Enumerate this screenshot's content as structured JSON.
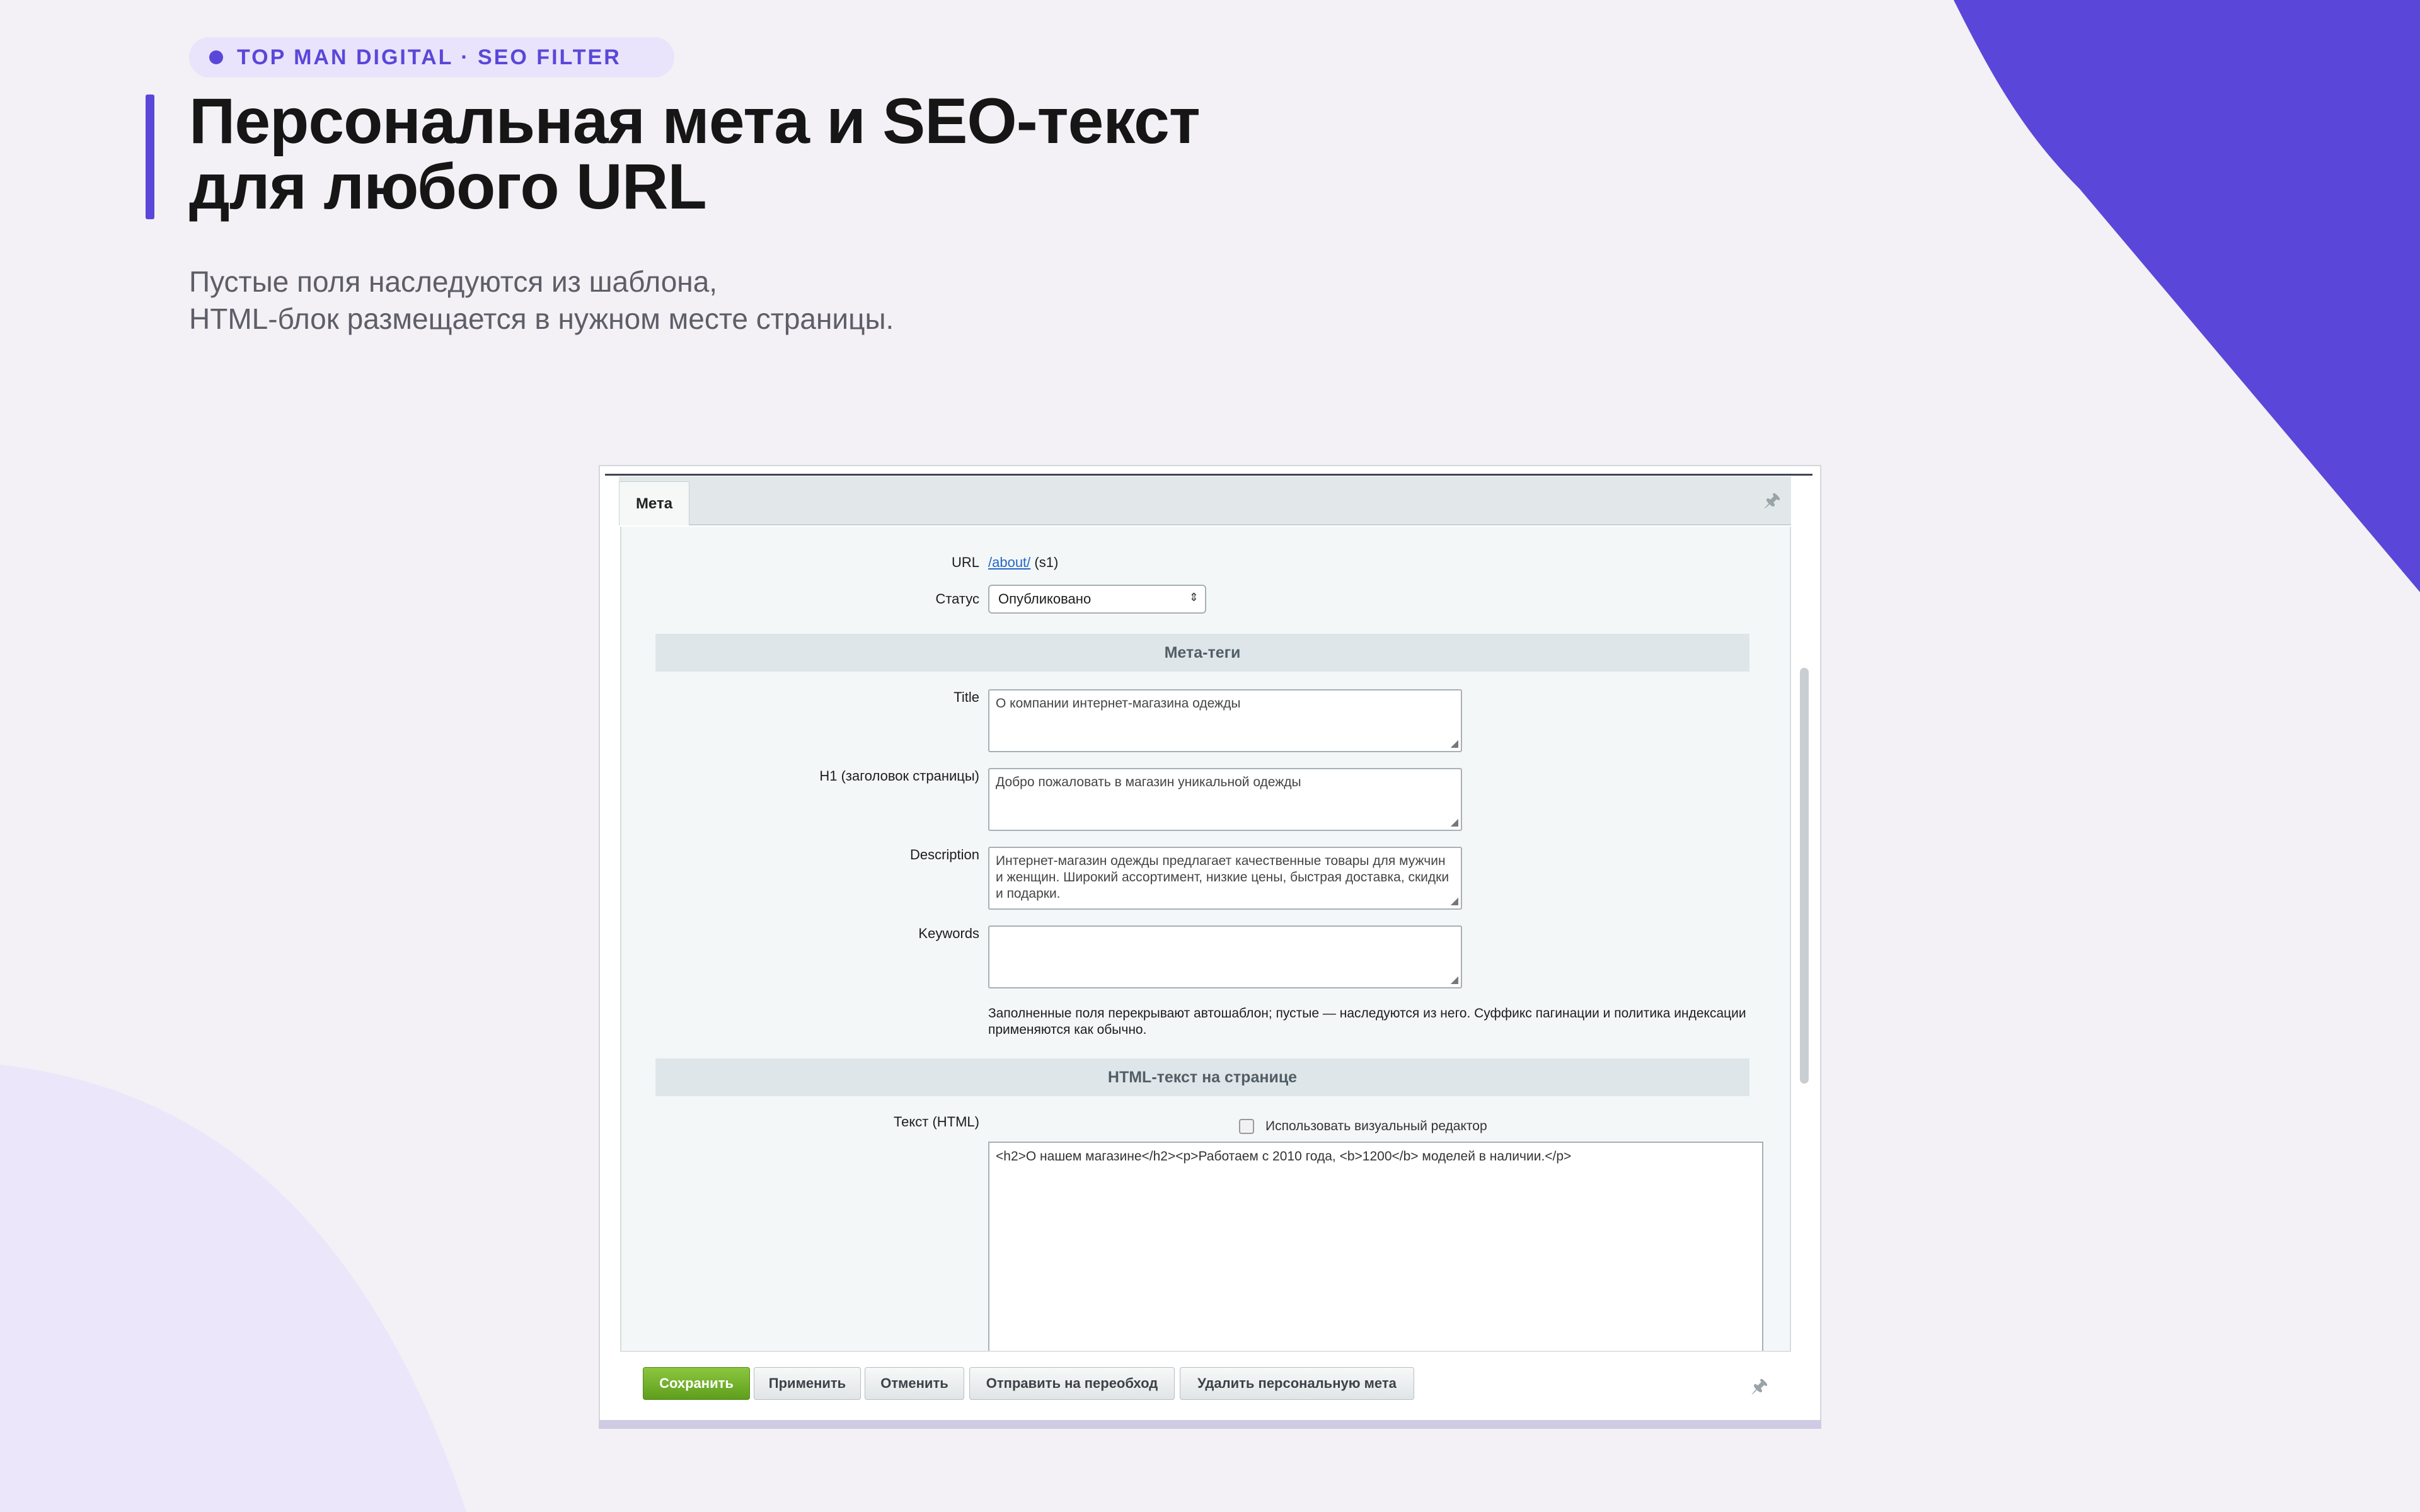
{
  "brand": {
    "badge": "TOP MAN DIGITAL · SEO FILTER",
    "accent_color": "#5a47d9"
  },
  "hero": {
    "title_line1": "Персональная мета и SEO-текст",
    "title_line2": "для любого URL",
    "subtitle_line1": "Пустые поля наследуются из шаблона,",
    "subtitle_line2": "HTML-блок размещается в нужном месте страницы."
  },
  "editor": {
    "tab_label": "Мета",
    "pin_icon": "pin-icon",
    "url_label": "URL",
    "url_link": "/about/",
    "url_site": "(s1)",
    "status_label": "Статус",
    "status_value": "Опубликовано",
    "section_meta": "Мета-теги",
    "fields": {
      "title_label": "Title",
      "title_value": "О компании интернет-магазина одежды",
      "h1_label": "H1 (заголовок страницы)",
      "h1_value": "Добро пожаловать в магазин уникальной одежды",
      "description_label": "Description",
      "description_value": "Интернет-магазин одежды предлагает качественные товары для мужчин и женщин. Широкий ассортимент, низкие цены, быстрая доставка, скидки и подарки.",
      "keywords_label": "Keywords",
      "keywords_value": ""
    },
    "note": "Заполненные поля перекрывают автошаблон; пустые — наследуются из него. Суффикс пагинации и политика индексации применяются как обычно.",
    "section_html": "HTML-текст на странице",
    "html_label": "Текст (HTML)",
    "visual_editor_label": "Использовать визуальный редактор",
    "visual_editor_checked": false,
    "html_value": "<h2>О нашем магазине</h2><p>Работаем с 2010 года, <b>1200</b> моделей в наличии.</p>"
  },
  "footer": {
    "save": "Сохранить",
    "apply": "Применить",
    "cancel": "Отменить",
    "recrawl": "Отправить на переобход",
    "delete": "Удалить персональную мета",
    "save_color": "#6aab25"
  }
}
